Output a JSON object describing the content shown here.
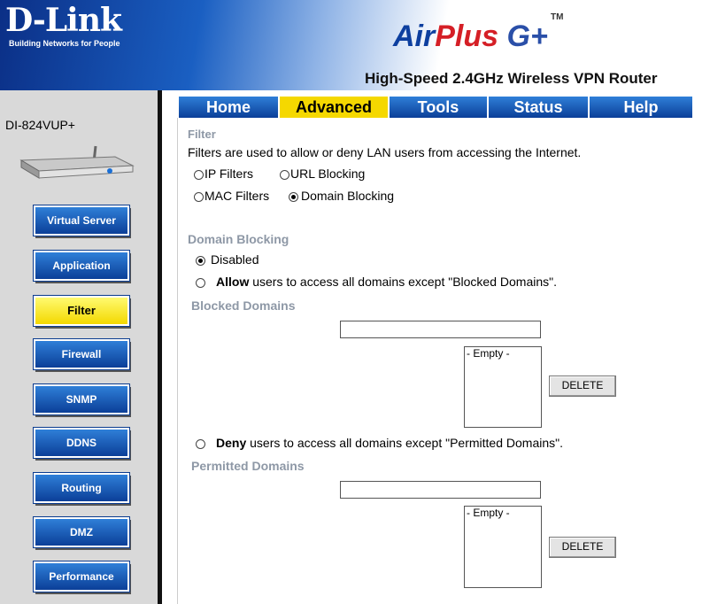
{
  "header": {
    "logo": "D-Link",
    "tagline": "Building Networks for People",
    "brand_air": "Air",
    "brand_plus": "Plus",
    "brand_g": "G+",
    "trademark": "TM",
    "product": "High-Speed 2.4GHz Wireless VPN Router"
  },
  "sidebar": {
    "model": "DI-824VUP+",
    "items": [
      {
        "label": "Virtual Server"
      },
      {
        "label": "Application"
      },
      {
        "label": "Filter"
      },
      {
        "label": "Firewall"
      },
      {
        "label": "SNMP"
      },
      {
        "label": "DDNS"
      },
      {
        "label": "Routing"
      },
      {
        "label": "DMZ"
      },
      {
        "label": "Performance"
      }
    ],
    "active": "Filter"
  },
  "tabs": [
    {
      "label": "Home"
    },
    {
      "label": "Advanced"
    },
    {
      "label": "Tools"
    },
    {
      "label": "Status"
    },
    {
      "label": "Help"
    }
  ],
  "content": {
    "title": "Filter",
    "description": "Filters are used to allow or deny LAN users from accessing the Internet.",
    "filter_types": {
      "ip": "IP Filters",
      "url": "URL Blocking",
      "mac": "MAC Filters",
      "domain": "Domain Blocking",
      "selected": "Domain Blocking"
    },
    "domain_blocking": {
      "heading": "Domain Blocking",
      "disabled": "Disabled",
      "allow_bold": "Allow",
      "allow_rest": "users to access all domains except \"Blocked Domains\".",
      "deny_bold": "Deny",
      "deny_rest": "users to access all domains except \"Permitted Domains\".",
      "selected": "Disabled"
    },
    "blocked": {
      "heading": "Blocked Domains",
      "input_value": "",
      "list_item": "- Empty -",
      "delete_label": "DELETE"
    },
    "permitted": {
      "heading": "Permitted Domains",
      "input_value": "",
      "list_item": "- Empty -",
      "delete_label": "DELETE"
    }
  }
}
